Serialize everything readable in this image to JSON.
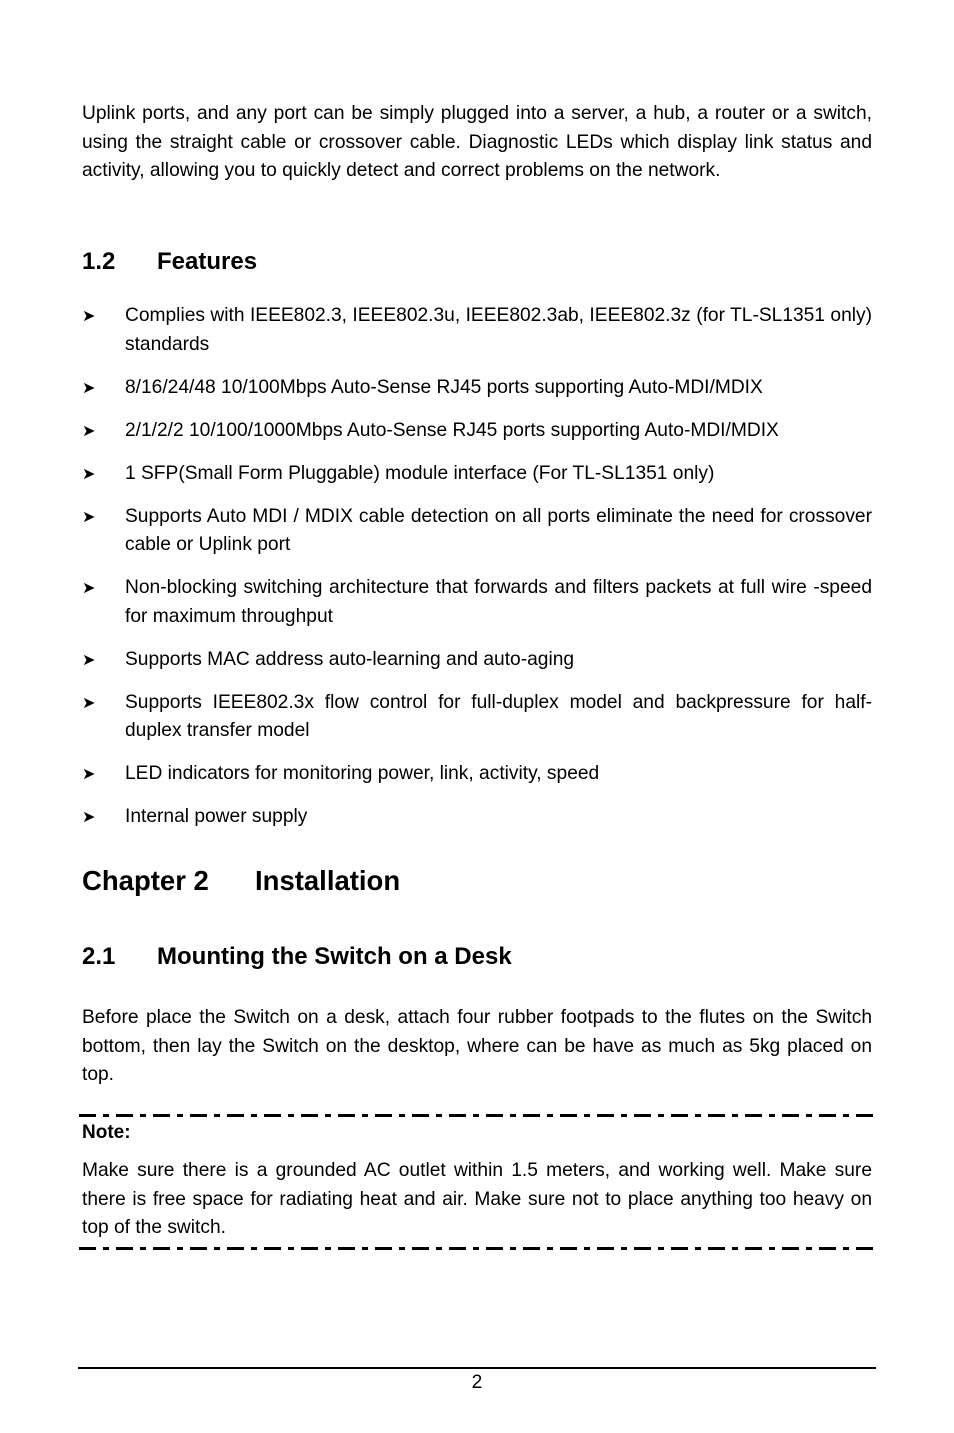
{
  "intro_paragraph": "Uplink ports, and any port can be simply plugged into a server, a hub, a router or a switch, using the straight cable or crossover cable. Diagnostic LEDs which display link status and activity, allowing you to quickly detect and correct problems on the network.",
  "section_1_2": {
    "number": "1.2",
    "title": "Features",
    "bullet_icon": "arrowhead-bullet",
    "items": [
      "Complies with IEEE802.3, IEEE802.3u, IEEE802.3ab, IEEE802.3z (for TL-SL1351 only) standards",
      "8/16/24/48 10/100Mbps Auto-Sense RJ45 ports supporting Auto-MDI/MDIX",
      "2/1/2/2 10/100/1000Mbps Auto-Sense RJ45 ports supporting Auto-MDI/MDIX",
      "1 SFP(Small Form Pluggable) module interface (For TL-SL1351 only)",
      "Supports Auto MDI / MDIX cable detection on all ports eliminate the need for crossover cable or Uplink port",
      "Non-blocking switching architecture that forwards and filters packets at full wire -speed for maximum throughput",
      "Supports MAC address auto-learning and auto-aging",
      "Supports IEEE802.3x flow control for full-duplex model and backpressure for half-duplex transfer model",
      "LED indicators for monitoring power, link, activity, speed",
      "Internal power supply"
    ]
  },
  "chapter_2": {
    "number": "Chapter 2",
    "title": "Installation"
  },
  "section_2_1": {
    "number": "2.1",
    "title": "Mounting the Switch on a Desk",
    "paragraph": "Before place the Switch on a desk, attach four rubber footpads to the flutes on the Switch bottom, then lay the Switch on the desktop, where can be have as much as 5kg placed on top."
  },
  "note": {
    "label": "Note:",
    "text": "Make sure there is a grounded AC outlet within 1.5 meters, and working well. Make sure there is free space for radiating heat and air. Make sure not to place anything too heavy on top of the switch."
  },
  "footer": {
    "page_number": "2"
  }
}
